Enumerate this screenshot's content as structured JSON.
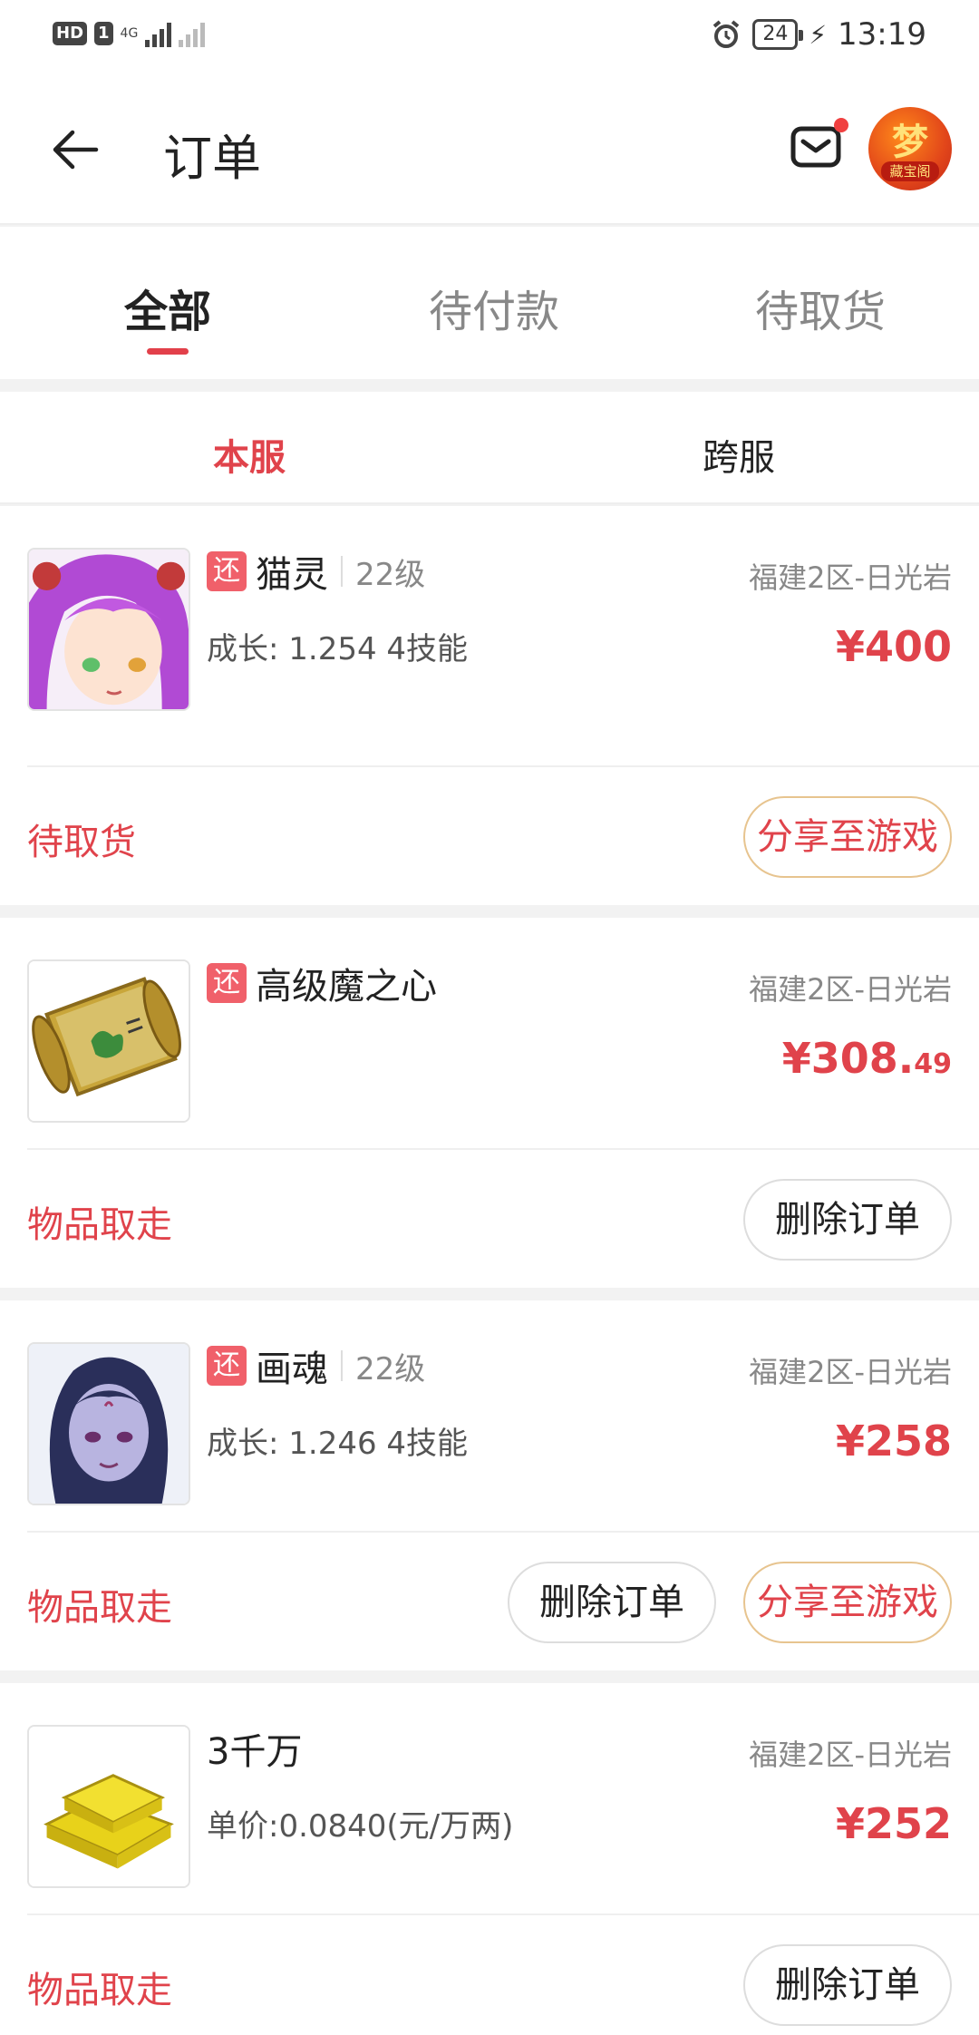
{
  "status_bar": {
    "hd": "HD",
    "sim": "1",
    "net": "4G",
    "battery": "24",
    "time": "13:19"
  },
  "header": {
    "title": "订单",
    "avatar_char": "梦",
    "avatar_sub": "藏宝阁"
  },
  "tabs": [
    {
      "label": "全部",
      "active": true
    },
    {
      "label": "待付款",
      "active": false
    },
    {
      "label": "待取货",
      "active": false
    }
  ],
  "subtabs": [
    {
      "label": "本服",
      "active": true
    },
    {
      "label": "跨服",
      "active": false
    }
  ],
  "orders": [
    {
      "tag": "还",
      "name": "猫灵",
      "level": "22级",
      "detail": "成长: 1.254  4技能",
      "server": "福建2区-日光岩",
      "price_main": "¥400",
      "price_dec": "",
      "status": "待取货",
      "buttons": [
        "分享至游戏"
      ]
    },
    {
      "tag": "还",
      "name": "高级魔之心",
      "level": "",
      "detail": "",
      "server": "福建2区-日光岩",
      "price_main": "¥308.",
      "price_dec": "49",
      "status": "物品取走",
      "buttons": [
        "删除订单"
      ]
    },
    {
      "tag": "还",
      "name": "画魂",
      "level": "22级",
      "detail": "成长: 1.246  4技能",
      "server": "福建2区-日光岩",
      "price_main": "¥258",
      "price_dec": "",
      "status": "物品取走",
      "buttons": [
        "删除订单",
        "分享至游戏"
      ]
    },
    {
      "tag": "",
      "name": "3千万",
      "level": "",
      "detail": "单价:0.0840(元/万两)",
      "server": "福建2区-日光岩",
      "price_main": "¥252",
      "price_dec": "",
      "status": "物品取走",
      "buttons": [
        "删除订单"
      ]
    }
  ],
  "colors": {
    "accent": "#e0434b",
    "tag": "#f0606a",
    "share_border": "#e7c48f"
  },
  "icons": [
    "back-arrow-icon",
    "mail-icon",
    "avatar-logo"
  ]
}
